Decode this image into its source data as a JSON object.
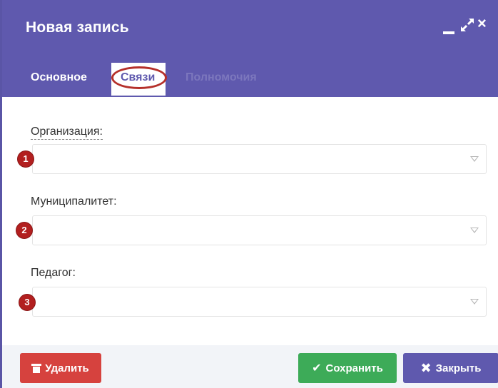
{
  "dialog": {
    "title": "Новая запись"
  },
  "window_controls": {
    "minimize_icon": "minimize-icon",
    "maximize_icon": "maximize-icon",
    "close_icon": "close-icon",
    "close_glyph": "×"
  },
  "tabs": [
    {
      "label": "Основное",
      "active": false
    },
    {
      "label": "Связи",
      "active": true
    },
    {
      "label": "Полномочия",
      "active": false,
      "disabled": true
    }
  ],
  "fields": [
    {
      "label": "Организация:",
      "value": "",
      "marker": "1"
    },
    {
      "label": "Муниципалитет:",
      "value": "",
      "marker": "2"
    },
    {
      "label": "Педагог:",
      "value": "",
      "marker": "3"
    }
  ],
  "buttons": {
    "delete": {
      "label": "Удалить",
      "icon": "trash-icon",
      "color": "#d6423e"
    },
    "save": {
      "label": "Сохранить",
      "icon": "check-icon",
      "glyph": "✔",
      "color": "#3dab58"
    },
    "close": {
      "label": "Закрыть",
      "icon": "x-icon",
      "glyph": "✖",
      "color": "#5f59ae"
    }
  },
  "colors": {
    "header": "#5f59ae",
    "marker": "#b21f1f",
    "highlight": "#b5302a"
  }
}
